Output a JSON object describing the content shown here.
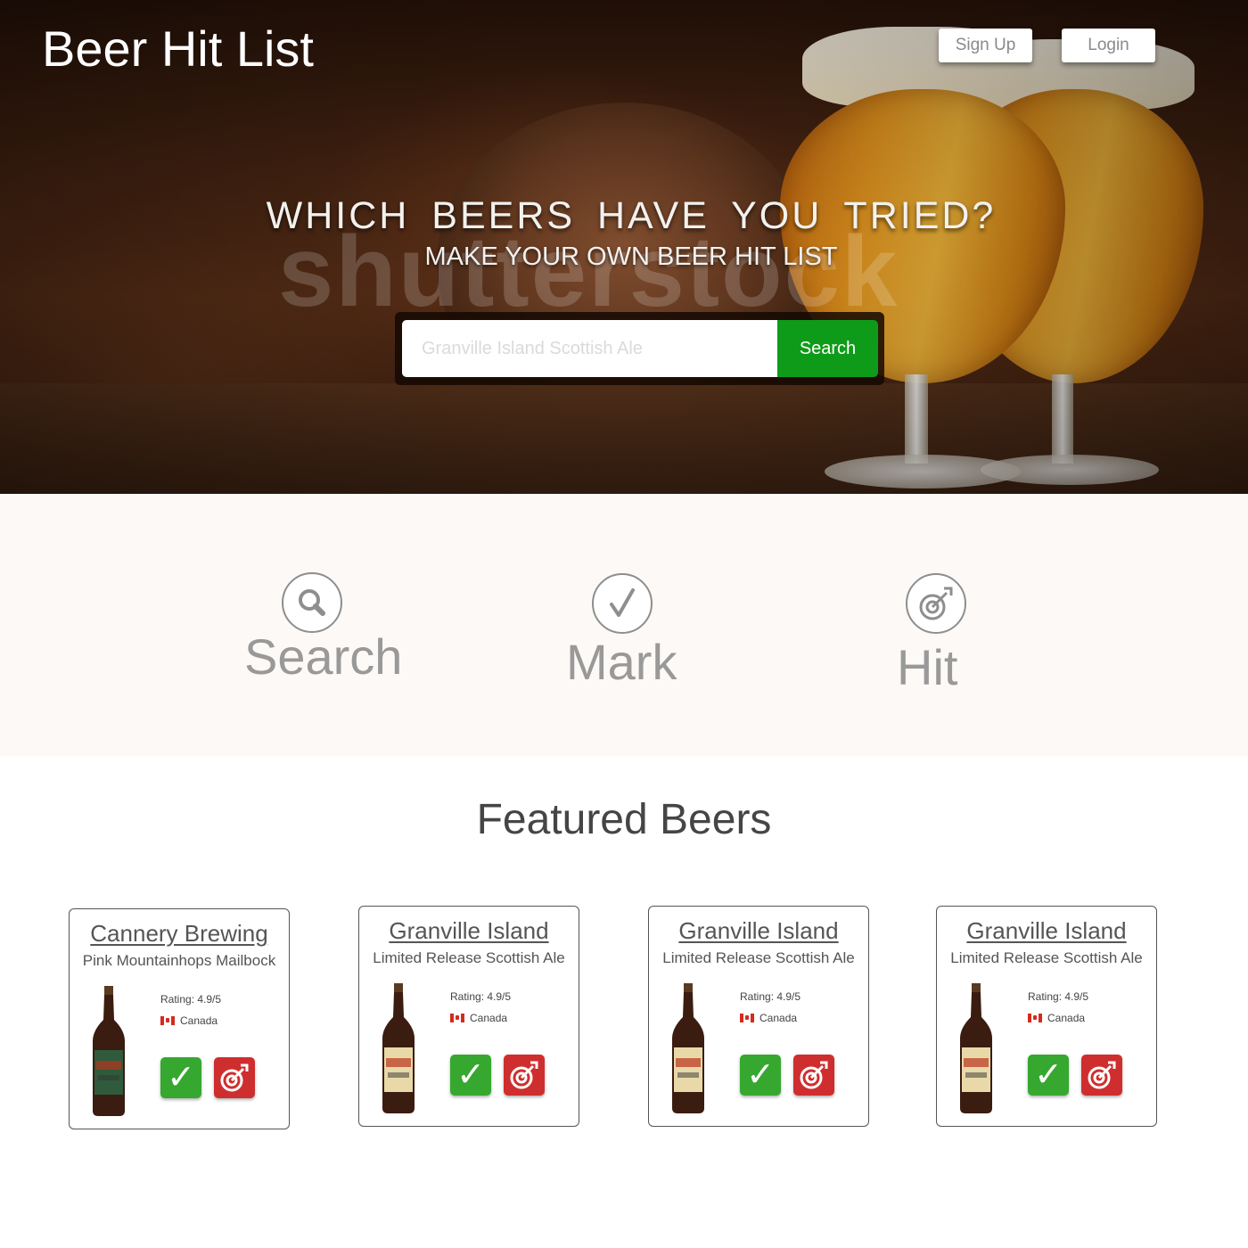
{
  "header": {
    "brand": "Beer Hit List",
    "signup_label": "Sign Up",
    "login_label": "Login"
  },
  "hero": {
    "headline": "WHICH BEERS HAVE YOU TRIED?",
    "subheadline": "MAKE YOUR OWN BEER HIT LIST",
    "watermark": "shutterstock",
    "search": {
      "placeholder": "Granville Island Scottish Ale",
      "button_label": "Search"
    }
  },
  "steps": [
    {
      "label": "Search",
      "icon": "search-icon"
    },
    {
      "label": "Mark",
      "icon": "checkmark-icon"
    },
    {
      "label": "Hit",
      "icon": "target-dart-icon"
    }
  ],
  "featured": {
    "title": "Featured Beers",
    "beers": [
      {
        "brewery": "Cannery Brewing",
        "name": "Pink Mountainhops Mailbock",
        "rating": "Rating: 4.9/5",
        "country": "Canada",
        "bottle_label_color": "#2f5a3c",
        "check_icon": "✓"
      },
      {
        "brewery": "Granville Island",
        "name": "Limited Release Scottish Ale",
        "rating": "Rating: 4.9/5",
        "country": "Canada",
        "bottle_label_color": "#e9d9a8",
        "check_icon": "✓"
      },
      {
        "brewery": "Granville Island",
        "name": "Limited Release Scottish Ale",
        "rating": "Rating: 4.9/5",
        "country": "Canada",
        "bottle_label_color": "#e9d9a8",
        "check_icon": "✓"
      },
      {
        "brewery": "Granville Island",
        "name": "Limited Release Scottish Ale",
        "rating": "Rating: 4.9/5",
        "country": "Canada",
        "bottle_label_color": "#e9d9a8",
        "check_icon": "✓"
      }
    ]
  },
  "colors": {
    "search_button": "#0f9b1a",
    "mark_button": "#36a82f",
    "hit_button": "#cf2e2e",
    "steps_background": "#fdf9f6"
  }
}
